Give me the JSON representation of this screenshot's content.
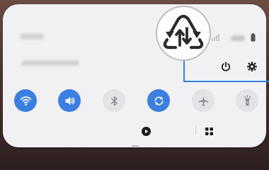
{
  "screen": {
    "wallpaper_color": "#4a332f",
    "panel_color": "#f1f1f3",
    "accent_on": "#3b7fe0",
    "accent_off": "#e3e3e7",
    "callout_line_color": "#2f84e0"
  },
  "status": {
    "time": "",
    "date": ""
  },
  "header_actions": {
    "power_icon": "power-icon",
    "settings_icon": "gear-icon"
  },
  "quick_settings": [
    {
      "name": "wifi",
      "icon": "wifi-icon",
      "state": "on"
    },
    {
      "name": "sound",
      "icon": "sound-icon",
      "state": "on"
    },
    {
      "name": "bluetooth",
      "icon": "bluetooth-icon",
      "state": "off"
    },
    {
      "name": "auto-rotate",
      "icon": "auto-rotate-icon",
      "state": "on"
    },
    {
      "name": "airplane-mode",
      "icon": "airplane-icon",
      "state": "off"
    },
    {
      "name": "flashlight",
      "icon": "flashlight-icon",
      "state": "off"
    }
  ],
  "bottom_bar": {
    "media_label": "",
    "devices_label": ""
  },
  "callout": {
    "icon": "data-saver-icon"
  }
}
